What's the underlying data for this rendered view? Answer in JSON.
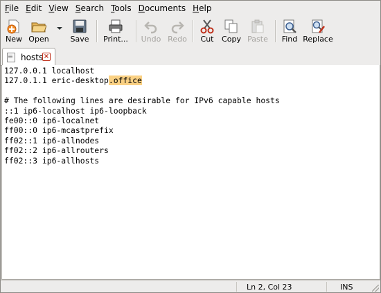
{
  "menubar": {
    "items": [
      {
        "key": "F",
        "rest": "ile"
      },
      {
        "key": "E",
        "rest": "dit"
      },
      {
        "key": "V",
        "rest": "iew"
      },
      {
        "key": "S",
        "rest": "earch"
      },
      {
        "key": "T",
        "rest": "ools"
      },
      {
        "key": "D",
        "rest": "ocuments"
      },
      {
        "key": "H",
        "rest": "elp"
      }
    ]
  },
  "toolbar": {
    "new": "New",
    "open": "Open",
    "save": "Save",
    "print": "Print...",
    "undo": "Undo",
    "redo": "Redo",
    "cut": "Cut",
    "copy": "Copy",
    "paste": "Paste",
    "find": "Find",
    "replace": "Replace"
  },
  "tab": {
    "name": "hosts"
  },
  "editor": {
    "lines": [
      "127.0.0.1 localhost",
      "127.0.1.1 eric-desktop",
      "",
      "# The following lines are desirable for IPv6 capable hosts",
      "::1 ip6-localhost ip6-loopback",
      "fe00::0 ip6-localnet",
      "ff00::0 ip6-mcastprefix",
      "ff02::1 ip6-allnodes",
      "ff02::2 ip6-allrouters",
      "ff02::3 ip6-allhosts"
    ],
    "highlighted_suffix": ".office"
  },
  "status": {
    "position": "Ln 2, Col 23",
    "mode": "INS"
  },
  "colors": {
    "highlight": "#fad184",
    "background": "#edeceb"
  }
}
